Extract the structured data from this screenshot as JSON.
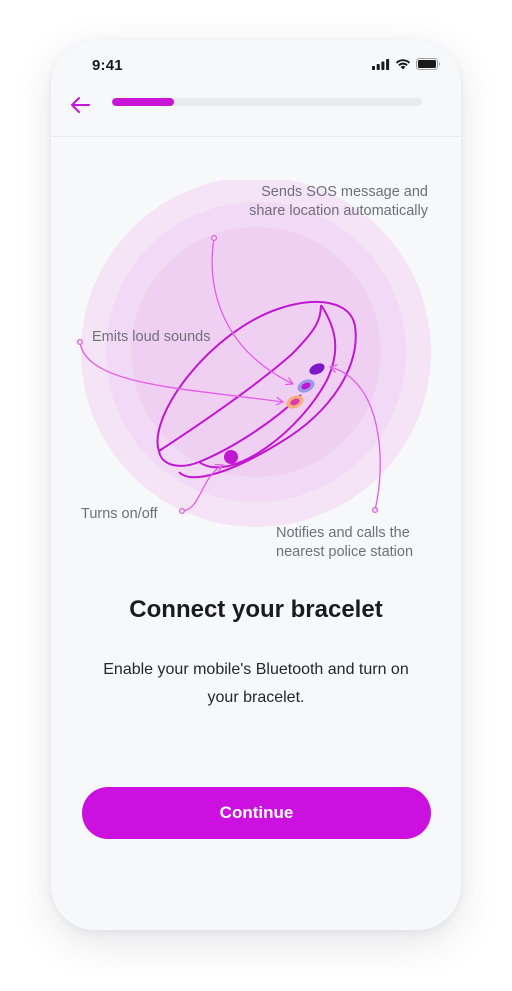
{
  "status_bar": {
    "time": "9:41",
    "icons": [
      "signal-icon",
      "wifi-icon",
      "battery-icon"
    ]
  },
  "nav": {
    "back_icon": "arrow-left-icon",
    "progress": 0.2
  },
  "illustration": {
    "annotations": {
      "sos": "Sends SOS message and\nshare location automatically",
      "sounds": "Emits loud sounds",
      "power": "Turns on/off",
      "police": "Notifies and calls the\nnearest police station"
    }
  },
  "content": {
    "title": "Connect your bracelet",
    "subtitle": "Enable your mobile's Bluetooth and turn on your bracelet."
  },
  "actions": {
    "continue_label": "Continue"
  },
  "colors": {
    "accent": "#cc10e0",
    "background": "#f7f8fa",
    "halo": "#f5dcf7"
  }
}
